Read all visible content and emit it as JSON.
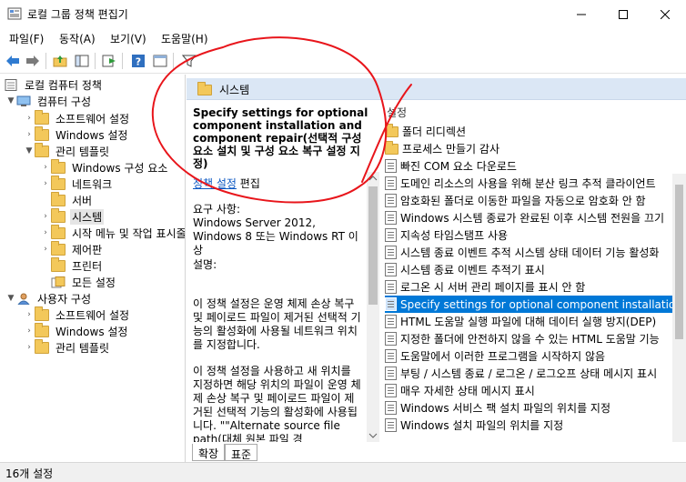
{
  "window": {
    "title": "로컬 그룹 정책 편집기"
  },
  "menu": [
    "파일(F)",
    "동작(A)",
    "보기(V)",
    "도움말(H)"
  ],
  "tree": {
    "root": "로컬 컴퓨터 정책",
    "computer": "컴퓨터 구성",
    "c_software": "소프트웨어 설정",
    "c_windows": "Windows 설정",
    "c_admin": "관리 템플릿",
    "c_admin_windows": "Windows 구성 요소",
    "c_admin_network": "네트워크",
    "c_admin_server": "서버",
    "c_admin_system": "시스템",
    "c_admin_start": "시작 메뉴 및 작업 표시줄",
    "c_admin_control": "제어판",
    "c_admin_printer": "프린터",
    "c_admin_all": "모든 설정",
    "user": "사용자 구성",
    "u_software": "소프트웨어 설정",
    "u_windows": "Windows 설정",
    "u_admin": "관리 템플릿"
  },
  "header": {
    "title": "시스템"
  },
  "description": {
    "title": "Specify settings for optional component installation and component repair(선택적 구성 요소 설치 및 구성 요소 복구 설정 지정)",
    "link": "정책 설정",
    "link_suffix": " 편집",
    "req_label": "요구 사항:",
    "req_text": "Windows Server 2012, Windows 8 또는 Windows RT 이상",
    "desc_label": "설명:",
    "para1": "이 정책 설정은 운영 체제 손상 복구 및 페이로드 파일이 제거된 선택적 기능의 활성화에 사용될 네트워크 위치를 지정합니다.",
    "para2": "이 정책 설정을 사용하고 새 위치를 지정하면 해당 위치의 파일이 운영 체제 손상 복구 및 페이로드 파일이 제거된 선택적 기능의 활성화에 사용됩니다. \"\"Alternate source file path(대체 원본 파일 경"
  },
  "list": {
    "column": "설정",
    "items": [
      {
        "kind": "folder",
        "label": "폴더 리디렉션"
      },
      {
        "kind": "folder",
        "label": "프로세스 만들기 감사"
      },
      {
        "kind": "doc",
        "label": "빠진 COM 요소 다운로드"
      },
      {
        "kind": "doc",
        "label": "도메인 리소스의 사용을 위해 분산 링크 추적 클라이언트"
      },
      {
        "kind": "doc",
        "label": "암호화된 폴더로 이동한 파일을 자동으로 암호화 안 함"
      },
      {
        "kind": "doc",
        "label": "Windows 시스템 종료가 완료된 이후 시스템 전원을 끄기"
      },
      {
        "kind": "doc",
        "label": "지속성 타임스탬프 사용"
      },
      {
        "kind": "doc",
        "label": "시스템 종료 이벤트 추적 시스템 상태 데이터 기능 활성화"
      },
      {
        "kind": "doc",
        "label": "시스템 종료 이벤트 추적기 표시"
      },
      {
        "kind": "doc",
        "label": "로그온 시 서버 관리 페이지를 표시 안 함"
      },
      {
        "kind": "doc",
        "label": "Specify settings for optional component installation and"
      },
      {
        "kind": "doc",
        "label": "HTML 도움말 실행 파일에 대해 데이터 실행 방지(DEP)"
      },
      {
        "kind": "doc",
        "label": "지정한 폴더에 안전하지 않을 수 있는 HTML 도움말 기능"
      },
      {
        "kind": "doc",
        "label": "도움말에서 이러한 프로그램을 시작하지 않음"
      },
      {
        "kind": "doc",
        "label": "부팅 / 시스템 종료 / 로그온 / 로그오프 상태 메시지 표시"
      },
      {
        "kind": "doc",
        "label": "매우 자세한 상태 메시지 표시"
      },
      {
        "kind": "doc",
        "label": "Windows 서비스 팩 설치 파일의 위치를 지정"
      },
      {
        "kind": "doc",
        "label": "Windows 설치 파일의 위치를 지정"
      }
    ]
  },
  "tabs": [
    "확장",
    "표준"
  ],
  "status": "16개 설정",
  "colors": {
    "selection": "#0078d7",
    "header": "#dbe7f5",
    "annotation": "#e8151b",
    "folder": "#f3c85a"
  }
}
